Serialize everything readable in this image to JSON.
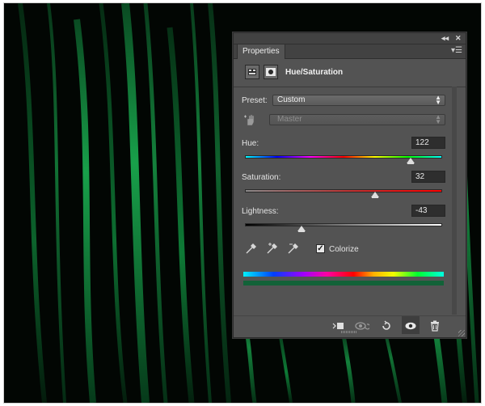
{
  "window": {
    "tab_label": "Properties",
    "adjustment_title": "Hue/Saturation"
  },
  "preset": {
    "label": "Preset:",
    "value": "Custom"
  },
  "channel": {
    "value": "Master"
  },
  "hue": {
    "label": "Hue:",
    "value": "122",
    "range": [
      -180,
      180
    ]
  },
  "saturation": {
    "label": "Saturation:",
    "value": "32",
    "range": [
      -100,
      100
    ]
  },
  "lightness": {
    "label": "Lightness:",
    "value": "-43",
    "range": [
      -100,
      100
    ]
  },
  "colorize": {
    "label": "Colorize",
    "checked": true,
    "check_glyph": "✓"
  },
  "icons": [
    "collapse-panel-icon",
    "close-panel-icon",
    "panel-menu-icon",
    "hue-saturation-adjustment-icon",
    "layer-mask-icon",
    "targeted-adjustment-hand-icon",
    "eyedropper-icon",
    "eyedropper-add-icon",
    "eyedropper-subtract-icon",
    "clip-to-layer-icon",
    "view-previous-state-icon",
    "reset-icon",
    "visibility-eye-icon",
    "trash-icon"
  ],
  "colors": {
    "panel_bg": "#535353",
    "result_bar": "#126238",
    "canvas_bg": "#020603"
  }
}
